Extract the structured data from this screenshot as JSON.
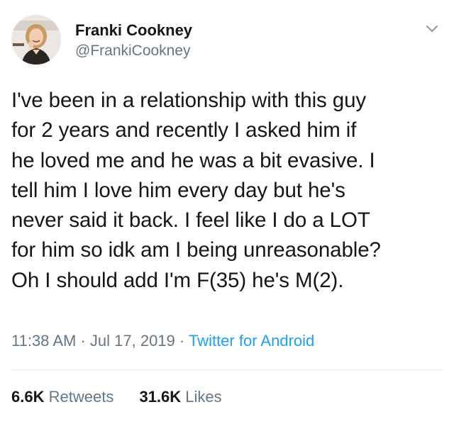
{
  "tweet": {
    "author": {
      "display_name": "Franki Cookney",
      "handle": "@FrankiCookney",
      "avatar_icon": "profile-photo"
    },
    "menu_icon": "chevron-down-icon",
    "text": "I've been in a relationship with this guy\nfor 2 years and recently I asked him if\nhe loved me and he was a bit evasive. I\ntell him I love him every day but he's\nnever said it back. I feel like I do a LOT\nfor him so idk am I being unreasonable?\nOh I should add I'm F(35) he's M(2).",
    "time": "11:38 AM",
    "separator": "·",
    "date": "Jul 17, 2019",
    "source": "Twitter for Android",
    "retweets": {
      "count": "6.6K",
      "label": "Retweets"
    },
    "likes": {
      "count": "31.6K",
      "label": "Likes"
    }
  },
  "colors": {
    "text": "#14171a",
    "secondary": "#657786",
    "link": "#1da1f2",
    "divider": "#e6ecf0"
  }
}
